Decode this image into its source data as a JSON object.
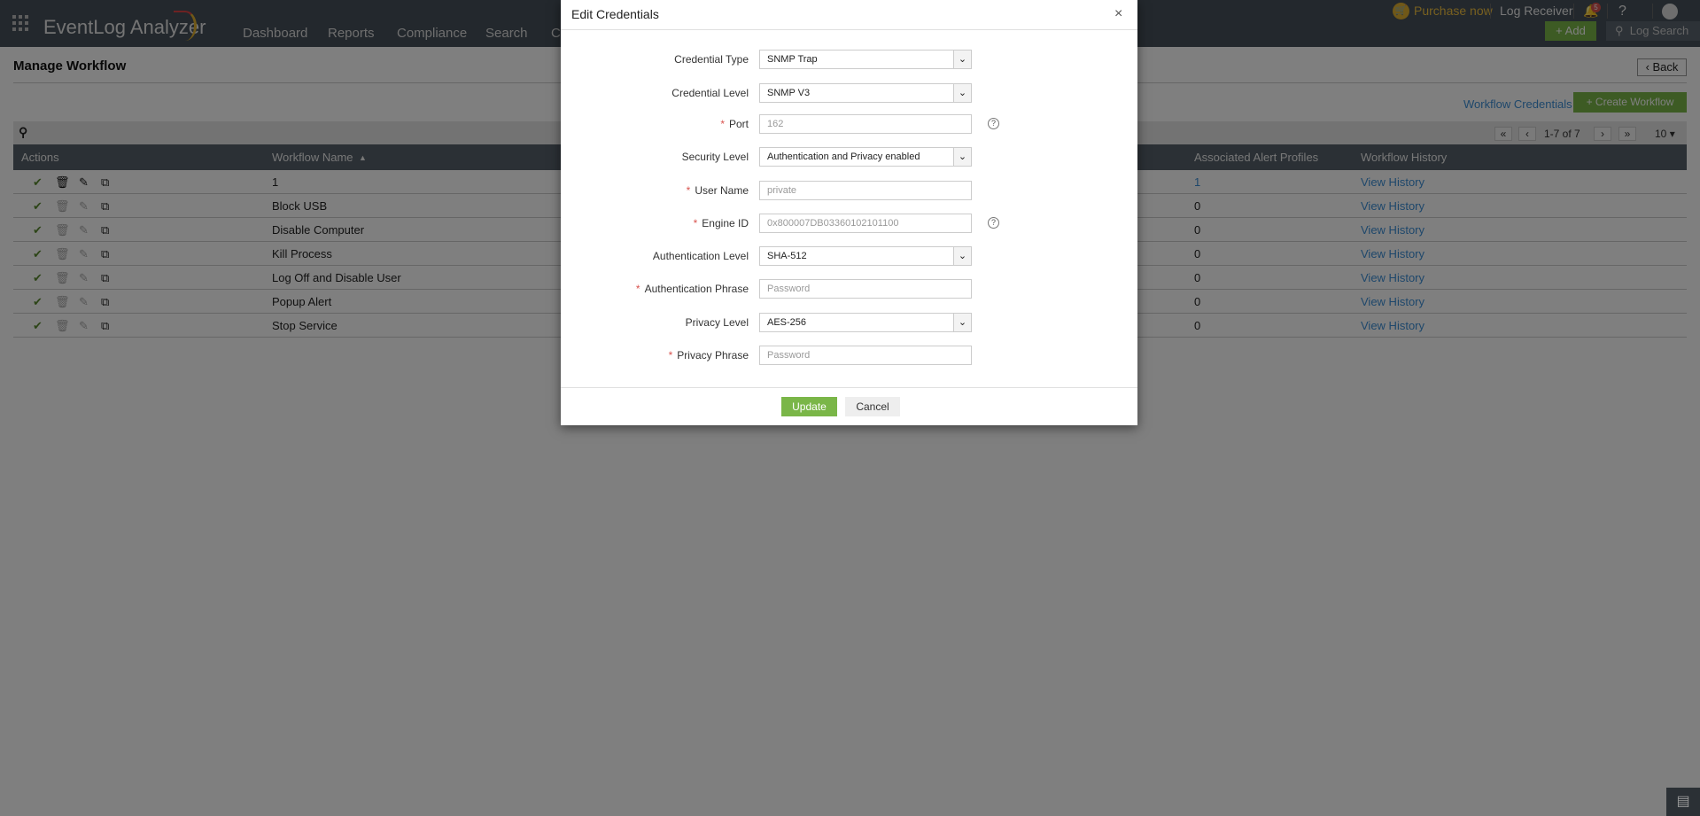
{
  "app": {
    "name": "EventLog Analyzer",
    "nav": [
      "Dashboard",
      "Reports",
      "Compliance",
      "Search",
      "Co"
    ],
    "purchase": "Purchase now",
    "log_receiver": "Log Receiver",
    "notif_count": "5",
    "help": "?",
    "add": "Add",
    "log_search": "Log Search"
  },
  "page": {
    "title": "Manage Workflow",
    "back": "Back",
    "workflow_credentials": "Workflow Credentials",
    "create_workflow": "Create Workflow",
    "pagination": {
      "range": "1-7 of 7",
      "per_page": "10"
    },
    "columns": [
      "Actions",
      "Workflow Name",
      "Associated Alert Profiles",
      "Workflow History"
    ],
    "rows": [
      {
        "name": "1",
        "profiles": "1",
        "history": "View History"
      },
      {
        "name": "Block USB",
        "profiles": "0",
        "history": "View History"
      },
      {
        "name": "Disable Computer",
        "profiles": "0",
        "history": "View History"
      },
      {
        "name": "Kill Process",
        "profiles": "0",
        "history": "View History"
      },
      {
        "name": "Log Off and Disable User",
        "profiles": "0",
        "history": "View History"
      },
      {
        "name": "Popup Alert",
        "profiles": "0",
        "history": "View History"
      },
      {
        "name": "Stop Service",
        "profiles": "0",
        "history": "View History"
      }
    ]
  },
  "dialog": {
    "title": "Edit Credentials",
    "close": "×",
    "fields": [
      {
        "label": "Credential Type",
        "value": "SNMP Trap",
        "type": "select"
      },
      {
        "label": "Credential Level",
        "value": "SNMP V3",
        "type": "select"
      },
      {
        "label": "Port",
        "placeholder": "162",
        "required": true,
        "help": true
      },
      {
        "label": "Security Level",
        "value": "Authentication and Privacy enabled",
        "type": "select"
      },
      {
        "label": "User Name",
        "placeholder": "private",
        "required": true
      },
      {
        "label": "Engine ID",
        "placeholder": "0x800007DB03360102101100",
        "required": true,
        "help": true
      },
      {
        "label": "Authentication Level",
        "value": "SHA-512",
        "type": "select"
      },
      {
        "label": "Authentication Phrase",
        "placeholder": "Password",
        "required": true
      },
      {
        "label": "Privacy Level",
        "value": "AES-256",
        "type": "select"
      },
      {
        "label": "Privacy Phrase",
        "placeholder": "Password",
        "required": true
      }
    ],
    "update": "Update",
    "cancel": "Cancel"
  },
  "colors": {
    "accent_green": "#7ab648",
    "link": "#3d8fd6",
    "topbar": "#46505a"
  }
}
